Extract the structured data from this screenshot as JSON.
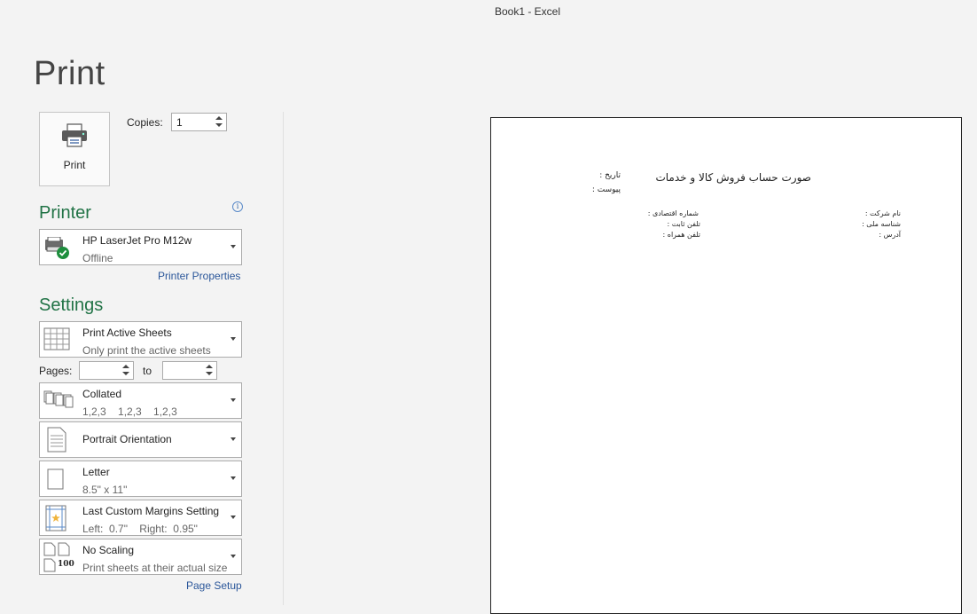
{
  "window": {
    "title": "Book1 - Excel"
  },
  "page_heading": "Print",
  "print_button": {
    "label": "Print",
    "icon": "printer-icon"
  },
  "copies": {
    "label": "Copies:",
    "value": "1"
  },
  "printer": {
    "section_title": "Printer",
    "name": "HP LaserJet Pro M12w",
    "status": "Offline",
    "properties_link": "Printer Properties",
    "status_color": "#1e8e3e"
  },
  "settings": {
    "section_title": "Settings",
    "print_what": {
      "title": "Print Active Sheets",
      "subtitle": "Only print the active sheets"
    },
    "pages": {
      "label": "Pages:",
      "from": "",
      "to_label": "to",
      "to": ""
    },
    "collation": {
      "title": "Collated",
      "subtitle": "1,2,3    1,2,3    1,2,3"
    },
    "orientation": {
      "title": "Portrait Orientation"
    },
    "paper": {
      "title": "Letter",
      "subtitle": "8.5\" x 11\""
    },
    "margins": {
      "title": "Last Custom Margins Setting",
      "subtitle": "Left:  0.7\"    Right:  0.95\""
    },
    "scaling": {
      "title": "No Scaling",
      "subtitle": "Print sheets at their actual size",
      "icon_number": "100"
    },
    "page_setup_link": "Page Setup"
  },
  "preview": {
    "title": "صورت حساب فروش کالا و خدمات",
    "date_label": "تاریخ :",
    "attachment_label": "پیوست :",
    "company_name_label": "نام شرکت :",
    "national_id_label": "شناسه ملی :",
    "address_label": "آدرس :",
    "economic_no_label": "شماره اقتصادی :",
    "phone_label": "تلفن ثابت :",
    "mobile_label": "تلفن همراه :"
  },
  "colors": {
    "accent": "#217346",
    "link": "#2b579a"
  }
}
